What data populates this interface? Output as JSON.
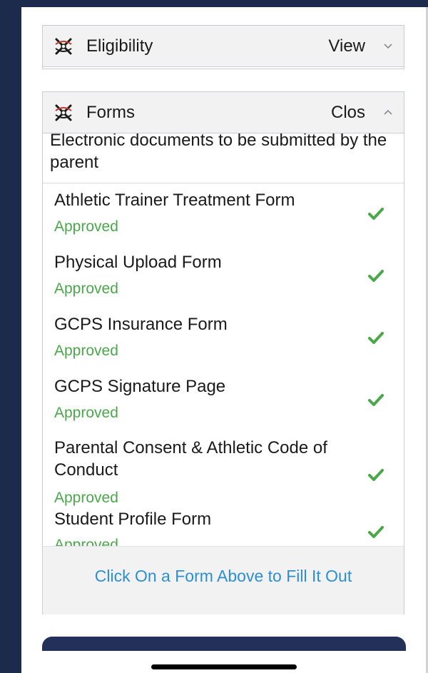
{
  "sections": {
    "eligibility": {
      "title": "Eligibility",
      "toggle": "View"
    },
    "forms": {
      "title": "Forms",
      "toggle": "Clos",
      "description": "Electronic documents to be submitted by the parent",
      "items": [
        {
          "title": "Athletic Trainer Treatment Form",
          "status": "Approved"
        },
        {
          "title": "Physical Upload Form",
          "status": "Approved"
        },
        {
          "title": "GCPS Insurance Form",
          "status": "Approved"
        },
        {
          "title": "GCPS Signature Page",
          "status": "Approved"
        },
        {
          "title": "Parental Consent & Athletic Code of Conduct",
          "status": "Approved"
        },
        {
          "title": "Student Profile Form",
          "status": "Approved"
        }
      ],
      "footer_link": "Click On a Form Above to Fill It Out"
    }
  },
  "colors": {
    "approved": "#4aa84a",
    "link": "#2c8fd3",
    "navy": "#1c2b4c",
    "icon_red": "#c0392b"
  },
  "icons": {
    "section": "app-logo-icon",
    "collapsed": "chevron-down-icon",
    "expanded": "chevron-up-icon",
    "status": "checkmark-icon"
  }
}
